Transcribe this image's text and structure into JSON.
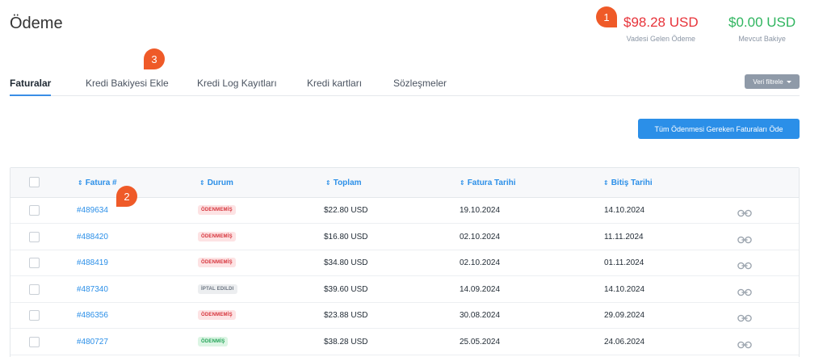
{
  "page": {
    "title": "Ödeme"
  },
  "balances": {
    "due": {
      "amount": "$98.28 USD",
      "label": "Vadesi Gelen Ödeme"
    },
    "available": {
      "amount": "$0.00 USD",
      "label": "Mevcut Bakiye"
    }
  },
  "markers": [
    "1",
    "2",
    "3"
  ],
  "tabs": [
    "Faturalar",
    "Kredi Bakiyesi Ekle",
    "Kredi Log Kayıtları",
    "Kredi kartları",
    "Sözleşmeler"
  ],
  "filter": {
    "label": "Veri filtrele"
  },
  "pay_all": {
    "label": "Tüm Ödenmesi Gereken Faturaları Öde"
  },
  "table": {
    "headers": [
      "Fatura #",
      "Durum",
      "Toplam",
      "Fatura Tarihi",
      "Bitiş Tarihi"
    ],
    "rows": [
      {
        "invoice": "#489634",
        "status": "ÖDENMEMİŞ",
        "status_type": "unpaid",
        "total": "$22.80 USD",
        "date": "19.10.2024",
        "due": "14.10.2024"
      },
      {
        "invoice": "#488420",
        "status": "ÖDENMEMİŞ",
        "status_type": "unpaid",
        "total": "$16.80 USD",
        "date": "02.10.2024",
        "due": "11.11.2024"
      },
      {
        "invoice": "#488419",
        "status": "ÖDENMEMİŞ",
        "status_type": "unpaid",
        "total": "$34.80 USD",
        "date": "02.10.2024",
        "due": "01.11.2024"
      },
      {
        "invoice": "#487340",
        "status": "İPTAL EDILDI",
        "status_type": "cancel",
        "total": "$39.60 USD",
        "date": "14.09.2024",
        "due": "14.10.2024"
      },
      {
        "invoice": "#486356",
        "status": "ÖDENMEMİŞ",
        "status_type": "unpaid",
        "total": "$23.88 USD",
        "date": "30.08.2024",
        "due": "29.09.2024"
      },
      {
        "invoice": "#480727",
        "status": "ÖDENMİŞ",
        "status_type": "paid",
        "total": "$38.28 USD",
        "date": "25.05.2024",
        "due": "24.06.2024"
      }
    ]
  },
  "colors": {
    "accent": "#2b8fe8",
    "due": "#e7333a",
    "available": "#2fb55f",
    "marker": "#ef5a28"
  }
}
